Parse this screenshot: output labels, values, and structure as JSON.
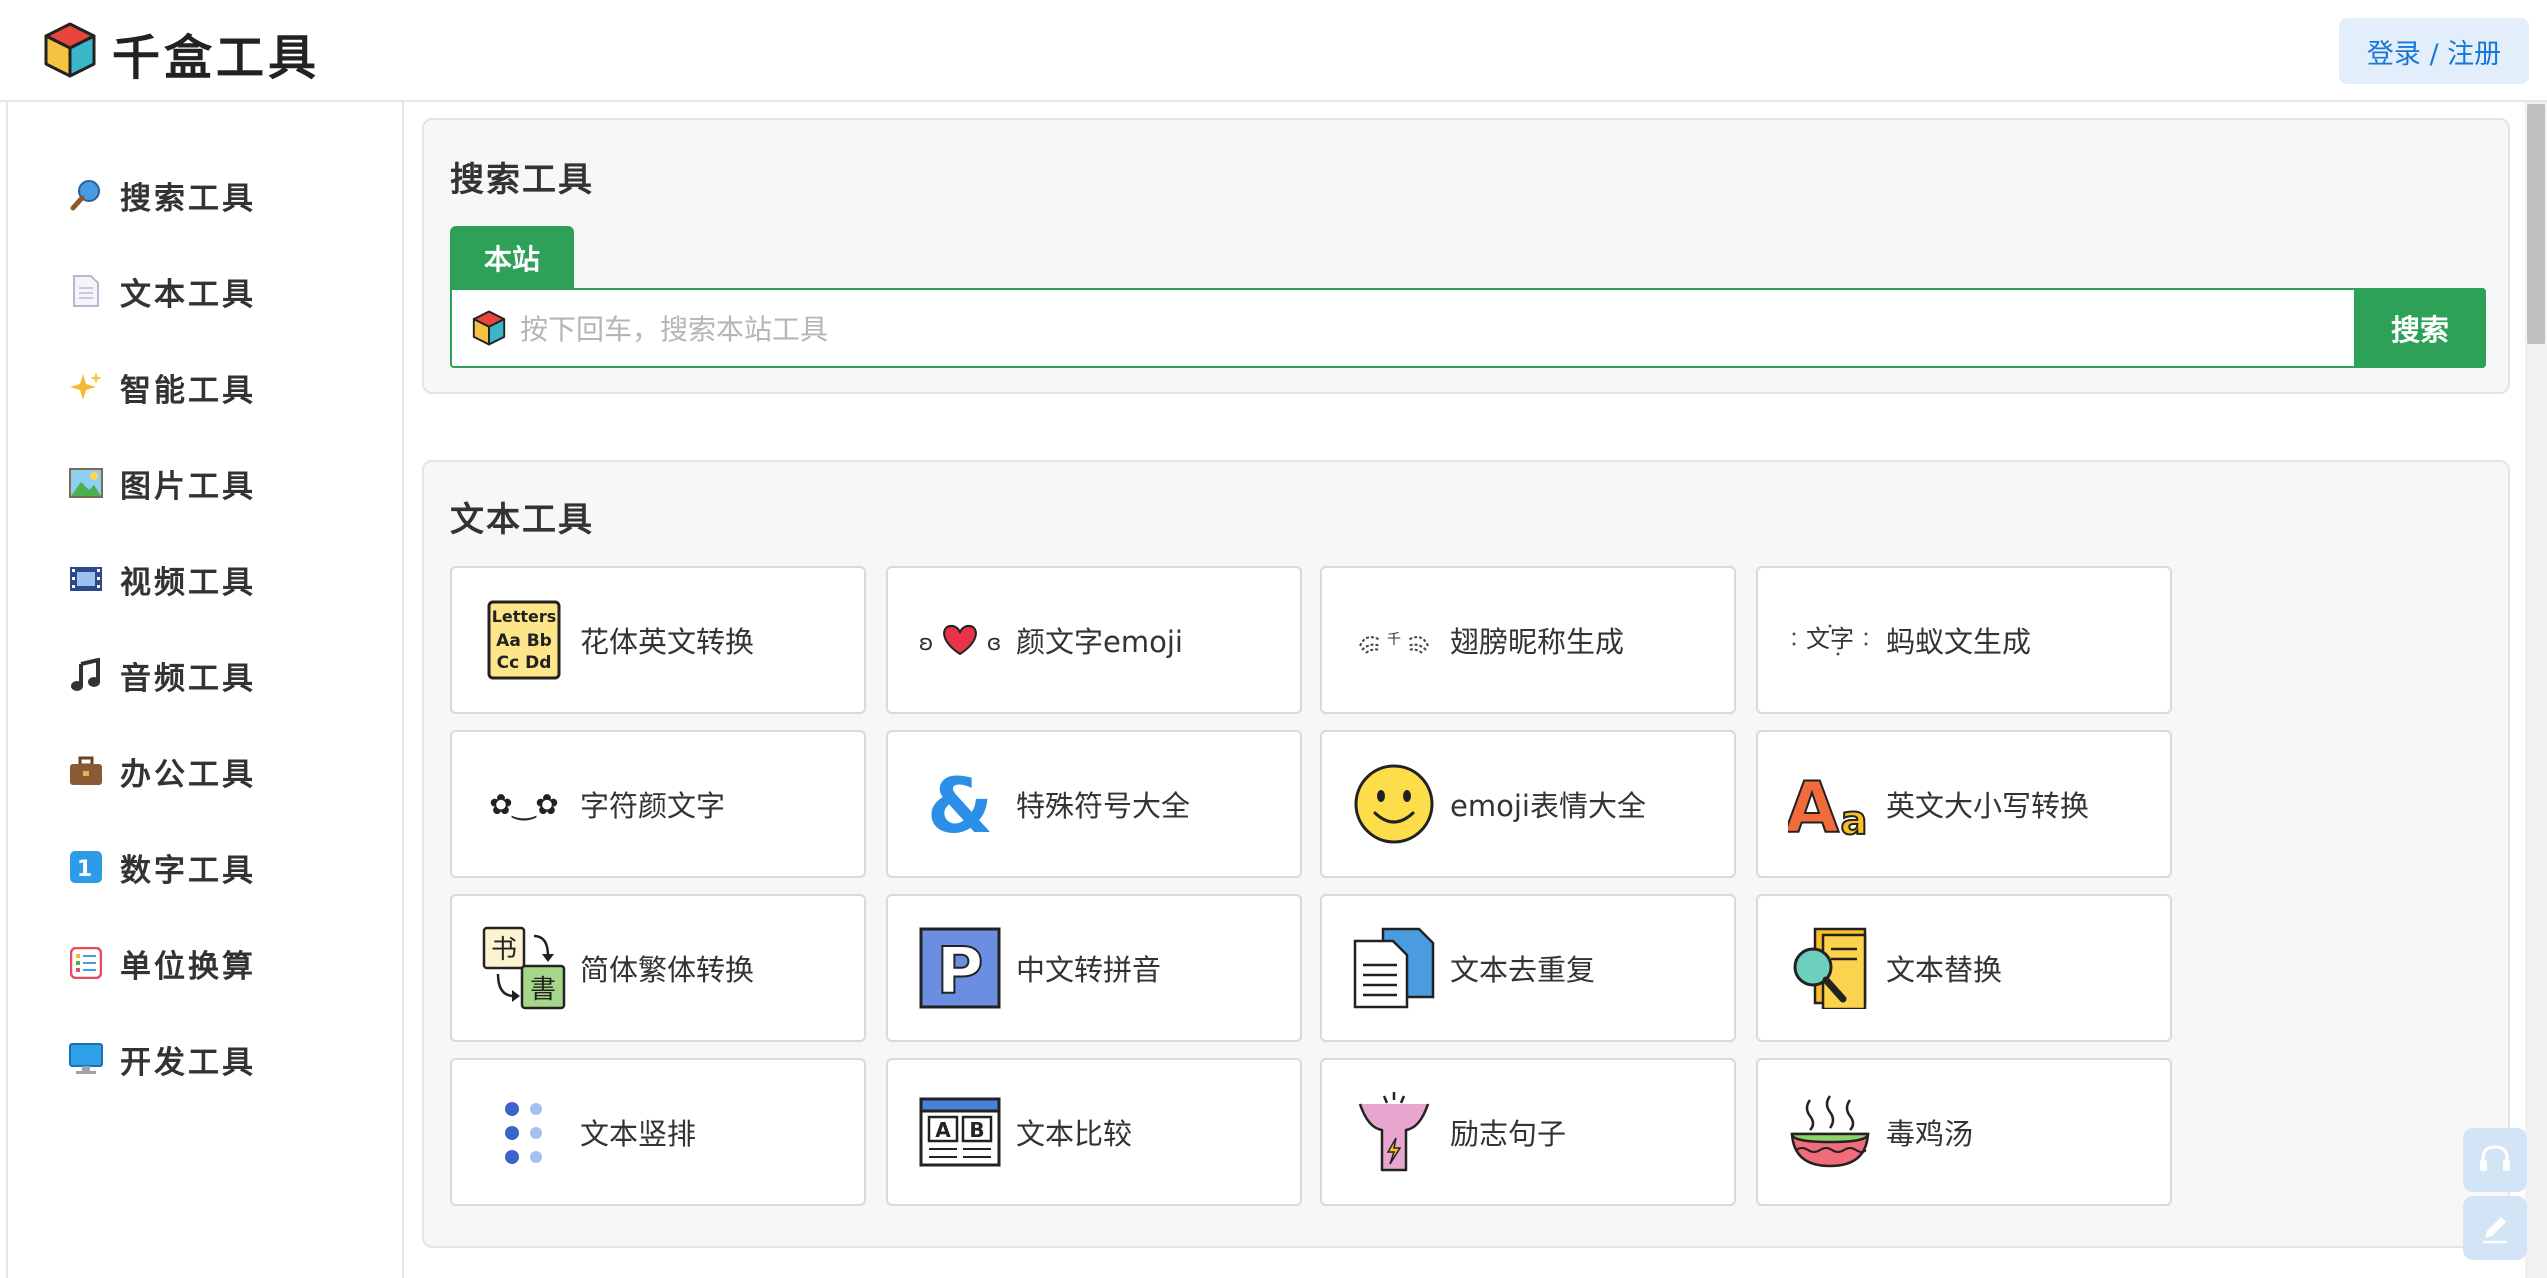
{
  "header": {
    "brand": "千盒工具",
    "login_label": "登录 / 注册"
  },
  "sidebar": {
    "items": [
      {
        "label": "搜索工具",
        "icon": "magnifier-icon"
      },
      {
        "label": "文本工具",
        "icon": "document-icon"
      },
      {
        "label": "智能工具",
        "icon": "sparkles-icon"
      },
      {
        "label": "图片工具",
        "icon": "picture-icon"
      },
      {
        "label": "视频工具",
        "icon": "film-icon"
      },
      {
        "label": "音频工具",
        "icon": "music-note-icon"
      },
      {
        "label": "办公工具",
        "icon": "briefcase-icon"
      },
      {
        "label": "数字工具",
        "icon": "number-one-icon"
      },
      {
        "label": "单位换算",
        "icon": "list-icon"
      },
      {
        "label": "开发工具",
        "icon": "monitor-icon"
      }
    ]
  },
  "search_section": {
    "title": "搜索工具",
    "tab_label": "本站",
    "placeholder": "按下回车，搜索本站工具",
    "button_label": "搜索"
  },
  "text_tools": {
    "title": "文本工具",
    "tools": [
      {
        "label": "花体英文转换",
        "icon": "letters-icon"
      },
      {
        "label": "颜文字emoji",
        "icon": "kaomoji-heart-icon"
      },
      {
        "label": "翅膀昵称生成",
        "icon": "wings-icon"
      },
      {
        "label": "蚂蚁文生成",
        "icon": "ant-text-icon"
      },
      {
        "label": "字符颜文字",
        "icon": "flower-face-icon"
      },
      {
        "label": "特殊符号大全",
        "icon": "ampersand-icon"
      },
      {
        "label": "emoji表情大全",
        "icon": "smiley-icon"
      },
      {
        "label": "英文大小写转换",
        "icon": "case-letters-icon"
      },
      {
        "label": "简体繁体转换",
        "icon": "book-convert-icon"
      },
      {
        "label": "中文转拼音",
        "icon": "letter-p-icon"
      },
      {
        "label": "文本去重复",
        "icon": "documents-icon"
      },
      {
        "label": "文本替换",
        "icon": "search-document-icon"
      },
      {
        "label": "文本竖排",
        "icon": "dot-columns-icon"
      },
      {
        "label": "文本比较",
        "icon": "compare-window-icon"
      },
      {
        "label": "励志句子",
        "icon": "cheering-person-icon"
      },
      {
        "label": "毒鸡汤",
        "icon": "soup-bowl-icon"
      }
    ],
    "ant_icon_text": "文字",
    "wings_icon_text": "千",
    "letters_icon_lines": [
      "Letters",
      "Aa Bb",
      "Cc Dd"
    ],
    "book_icon_chars": [
      "书",
      "書"
    ],
    "case_icon_chars": [
      "A",
      "a"
    ],
    "compare_icon_chars": [
      "A",
      "B"
    ],
    "pinyin_icon_char": "P",
    "ampersand_char": "&",
    "kaomoji_eyes": [
      "ʚ",
      "ɞ"
    ],
    "flower_face": "✿‿✿",
    "number_icon_char": "1"
  }
}
